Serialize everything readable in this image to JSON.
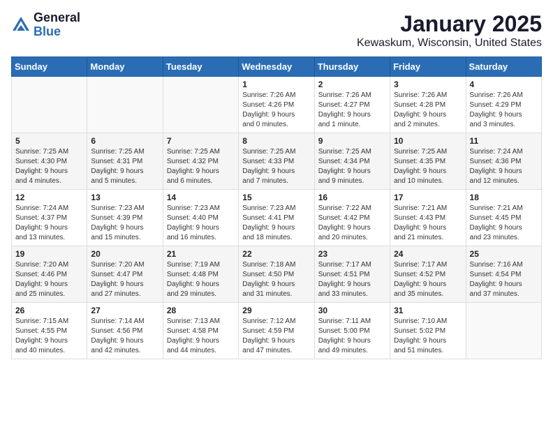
{
  "logo": {
    "general": "General",
    "blue": "Blue"
  },
  "title": "January 2025",
  "subtitle": "Kewaskum, Wisconsin, United States",
  "days_of_week": [
    "Sunday",
    "Monday",
    "Tuesday",
    "Wednesday",
    "Thursday",
    "Friday",
    "Saturday"
  ],
  "weeks": [
    [
      {
        "day": "",
        "info": ""
      },
      {
        "day": "",
        "info": ""
      },
      {
        "day": "",
        "info": ""
      },
      {
        "day": "1",
        "info": "Sunrise: 7:26 AM\nSunset: 4:26 PM\nDaylight: 9 hours\nand 0 minutes."
      },
      {
        "day": "2",
        "info": "Sunrise: 7:26 AM\nSunset: 4:27 PM\nDaylight: 9 hours\nand 1 minute."
      },
      {
        "day": "3",
        "info": "Sunrise: 7:26 AM\nSunset: 4:28 PM\nDaylight: 9 hours\nand 2 minutes."
      },
      {
        "day": "4",
        "info": "Sunrise: 7:26 AM\nSunset: 4:29 PM\nDaylight: 9 hours\nand 3 minutes."
      }
    ],
    [
      {
        "day": "5",
        "info": "Sunrise: 7:25 AM\nSunset: 4:30 PM\nDaylight: 9 hours\nand 4 minutes."
      },
      {
        "day": "6",
        "info": "Sunrise: 7:25 AM\nSunset: 4:31 PM\nDaylight: 9 hours\nand 5 minutes."
      },
      {
        "day": "7",
        "info": "Sunrise: 7:25 AM\nSunset: 4:32 PM\nDaylight: 9 hours\nand 6 minutes."
      },
      {
        "day": "8",
        "info": "Sunrise: 7:25 AM\nSunset: 4:33 PM\nDaylight: 9 hours\nand 7 minutes."
      },
      {
        "day": "9",
        "info": "Sunrise: 7:25 AM\nSunset: 4:34 PM\nDaylight: 9 hours\nand 9 minutes."
      },
      {
        "day": "10",
        "info": "Sunrise: 7:25 AM\nSunset: 4:35 PM\nDaylight: 9 hours\nand 10 minutes."
      },
      {
        "day": "11",
        "info": "Sunrise: 7:24 AM\nSunset: 4:36 PM\nDaylight: 9 hours\nand 12 minutes."
      }
    ],
    [
      {
        "day": "12",
        "info": "Sunrise: 7:24 AM\nSunset: 4:37 PM\nDaylight: 9 hours\nand 13 minutes."
      },
      {
        "day": "13",
        "info": "Sunrise: 7:23 AM\nSunset: 4:39 PM\nDaylight: 9 hours\nand 15 minutes."
      },
      {
        "day": "14",
        "info": "Sunrise: 7:23 AM\nSunset: 4:40 PM\nDaylight: 9 hours\nand 16 minutes."
      },
      {
        "day": "15",
        "info": "Sunrise: 7:23 AM\nSunset: 4:41 PM\nDaylight: 9 hours\nand 18 minutes."
      },
      {
        "day": "16",
        "info": "Sunrise: 7:22 AM\nSunset: 4:42 PM\nDaylight: 9 hours\nand 20 minutes."
      },
      {
        "day": "17",
        "info": "Sunrise: 7:21 AM\nSunset: 4:43 PM\nDaylight: 9 hours\nand 21 minutes."
      },
      {
        "day": "18",
        "info": "Sunrise: 7:21 AM\nSunset: 4:45 PM\nDaylight: 9 hours\nand 23 minutes."
      }
    ],
    [
      {
        "day": "19",
        "info": "Sunrise: 7:20 AM\nSunset: 4:46 PM\nDaylight: 9 hours\nand 25 minutes."
      },
      {
        "day": "20",
        "info": "Sunrise: 7:20 AM\nSunset: 4:47 PM\nDaylight: 9 hours\nand 27 minutes."
      },
      {
        "day": "21",
        "info": "Sunrise: 7:19 AM\nSunset: 4:48 PM\nDaylight: 9 hours\nand 29 minutes."
      },
      {
        "day": "22",
        "info": "Sunrise: 7:18 AM\nSunset: 4:50 PM\nDaylight: 9 hours\nand 31 minutes."
      },
      {
        "day": "23",
        "info": "Sunrise: 7:17 AM\nSunset: 4:51 PM\nDaylight: 9 hours\nand 33 minutes."
      },
      {
        "day": "24",
        "info": "Sunrise: 7:17 AM\nSunset: 4:52 PM\nDaylight: 9 hours\nand 35 minutes."
      },
      {
        "day": "25",
        "info": "Sunrise: 7:16 AM\nSunset: 4:54 PM\nDaylight: 9 hours\nand 37 minutes."
      }
    ],
    [
      {
        "day": "26",
        "info": "Sunrise: 7:15 AM\nSunset: 4:55 PM\nDaylight: 9 hours\nand 40 minutes."
      },
      {
        "day": "27",
        "info": "Sunrise: 7:14 AM\nSunset: 4:56 PM\nDaylight: 9 hours\nand 42 minutes."
      },
      {
        "day": "28",
        "info": "Sunrise: 7:13 AM\nSunset: 4:58 PM\nDaylight: 9 hours\nand 44 minutes."
      },
      {
        "day": "29",
        "info": "Sunrise: 7:12 AM\nSunset: 4:59 PM\nDaylight: 9 hours\nand 47 minutes."
      },
      {
        "day": "30",
        "info": "Sunrise: 7:11 AM\nSunset: 5:00 PM\nDaylight: 9 hours\nand 49 minutes."
      },
      {
        "day": "31",
        "info": "Sunrise: 7:10 AM\nSunset: 5:02 PM\nDaylight: 9 hours\nand 51 minutes."
      },
      {
        "day": "",
        "info": ""
      }
    ]
  ]
}
